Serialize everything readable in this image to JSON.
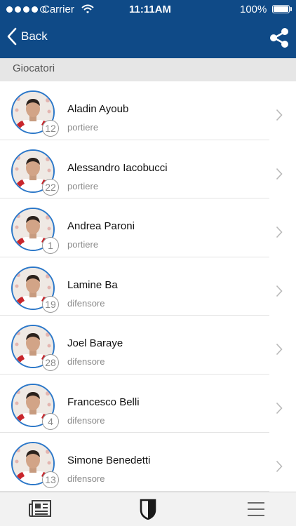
{
  "status_bar": {
    "carrier": "Carrier",
    "time": "11:11AM",
    "battery": "100%"
  },
  "nav": {
    "back_label": "Back",
    "back_icon": "chevron-left-icon",
    "share_icon": "share-icon"
  },
  "section_title": "Giocatori",
  "players": [
    {
      "name": "Aladin Ayoub",
      "number": "12",
      "role": "portiere"
    },
    {
      "name": "Alessandro Iacobucci",
      "number": "22",
      "role": "portiere"
    },
    {
      "name": "Andrea Paroni",
      "number": "1",
      "role": "portiere"
    },
    {
      "name": "Lamine Ba",
      "number": "19",
      "role": "difensore"
    },
    {
      "name": "Joel Baraye",
      "number": "28",
      "role": "difensore"
    },
    {
      "name": "Francesco Belli",
      "number": "4",
      "role": "difensore"
    },
    {
      "name": "Simone Benedetti",
      "number": "13",
      "role": "difensore"
    }
  ],
  "tabbar": {
    "items": [
      "news-icon",
      "shield-icon",
      "menu-icon"
    ],
    "active_tab": "shield-icon"
  },
  "colors": {
    "header": "#0f4a87",
    "avatar_ring": "#2c78c9",
    "section_bg": "#e6e6e6"
  }
}
